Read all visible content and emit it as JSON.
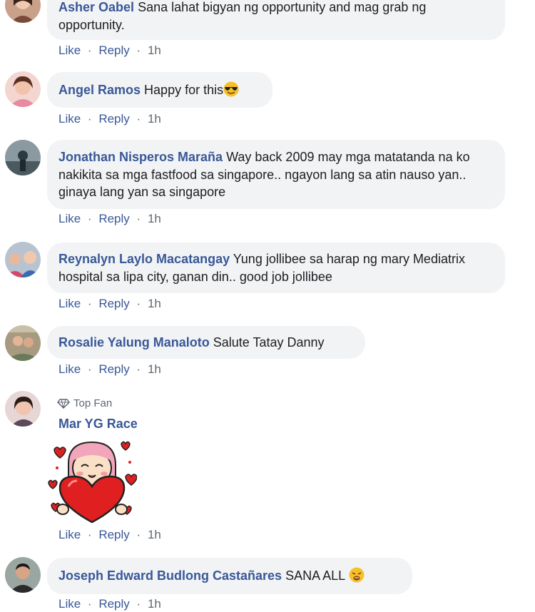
{
  "comments": [
    {
      "author": "Asher Oabel",
      "text": "Sana lahat bigyan ng opportunity and mag grab ng opportunity.",
      "like": "Like",
      "reply": "Reply",
      "time": "1h"
    },
    {
      "author": "Angel Ramos",
      "text": "Happy for this",
      "emoji": "sunglasses-emoji",
      "like": "Like",
      "reply": "Reply",
      "time": "1h"
    },
    {
      "author": "Jonathan Nisperos Maraña",
      "text": "Way back 2009 may mga matatanda na ko nakikita sa mga fastfood sa singapore.. ngayon lang sa atin nauso yan.. ginaya lang yan sa singapore",
      "like": "Like",
      "reply": "Reply",
      "time": "1h"
    },
    {
      "author": "Reynalyn Laylo Macatangay",
      "text": "Yung jollibee sa harap ng mary Mediatrix hospital sa lipa city, ganan din.. good job jollibee",
      "like": "Like",
      "reply": "Reply",
      "time": "1h"
    },
    {
      "author": "Rosalie Yalung Manaloto",
      "text": "Salute Tatay Danny",
      "like": "Like",
      "reply": "Reply",
      "time": "1h"
    },
    {
      "badge": "Top Fan",
      "author": "Mar YG Race",
      "sticker": "girl-holding-heart-sticker",
      "like": "Like",
      "reply": "Reply",
      "time": "1h"
    },
    {
      "author": "Joseph Edward Budlong Castañares",
      "text": "SANA ALL",
      "emoji": "weary-face-emoji",
      "like": "Like",
      "reply": "Reply",
      "time": "1h"
    }
  ],
  "separator": "·",
  "colors": {
    "link": "#385898",
    "meta": "#606770",
    "bubble": "#f2f3f5",
    "text": "#1c1e21"
  }
}
